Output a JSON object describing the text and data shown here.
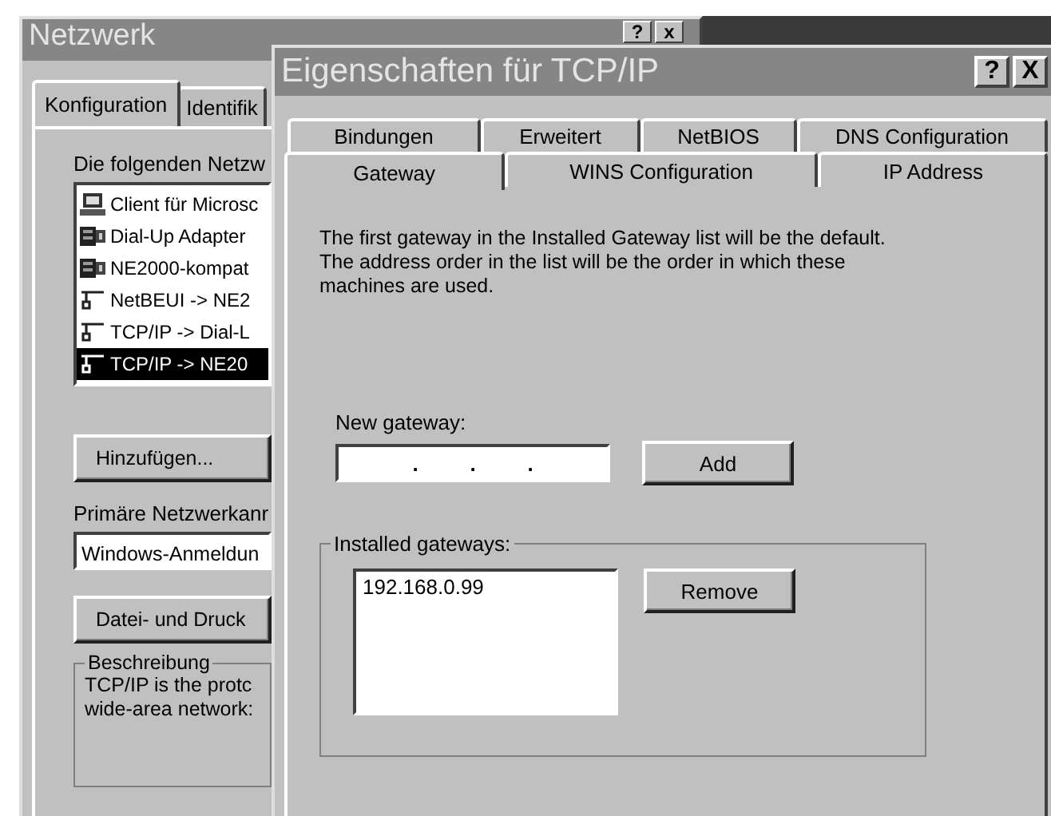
{
  "back_window": {
    "title": "Netzwerk",
    "title_buttons": [
      "?",
      "x"
    ],
    "tabs": [
      {
        "label": "Konfiguration",
        "selected": true
      },
      {
        "label": "Identifik",
        "selected": false
      }
    ],
    "list_label": "Die folgenden Netzw",
    "components": [
      {
        "kind": "client",
        "label": "Client für Microsc",
        "selected": false
      },
      {
        "kind": "adapter",
        "label": "Dial-Up Adapter",
        "selected": false
      },
      {
        "kind": "adapter",
        "label": "NE2000-kompat",
        "selected": false
      },
      {
        "kind": "protocol",
        "label": "NetBEUI -> NE2",
        "selected": false
      },
      {
        "kind": "protocol",
        "label": "TCP/IP -> Dial-L",
        "selected": false
      },
      {
        "kind": "protocol",
        "label": "TCP/IP -> NE20",
        "selected": true
      }
    ],
    "add_button": "Hinzufügen...",
    "logon_label": "Primäre Netzwerkanr",
    "logon_value": "Windows-Anmeldun",
    "sharing_button": "Datei- und Druck",
    "description": {
      "legend": "Beschreibung",
      "lines": [
        "TCP/IP is the protc",
        "wide-area network:"
      ]
    }
  },
  "window": {
    "title": "Eigenschaften für TCP/IP",
    "title_buttons": [
      "?",
      "X"
    ],
    "tab_rows": [
      [
        {
          "label": "Bindungen",
          "selected": false
        },
        {
          "label": "Erweitert",
          "selected": false
        },
        {
          "label": "NetBIOS",
          "selected": false
        },
        {
          "label": "DNS Configuration",
          "selected": false
        }
      ],
      [
        {
          "label": "Gateway",
          "selected": true
        },
        {
          "label": "WINS Configuration",
          "selected": false
        },
        {
          "label": "IP Address",
          "selected": false
        }
      ]
    ],
    "info_lines": [
      "The first gateway in the Installed Gateway list will be the default.",
      "The address order in the list will be the order in which these",
      "machines are used."
    ],
    "new_gateway_label": "New gateway:",
    "new_gateway_dots": [
      ".",
      ".",
      "."
    ],
    "add_button": "Add",
    "installed": {
      "legend": "Installed gateways:",
      "items": [
        "192.168.0.99"
      ],
      "remove_button": "Remove"
    }
  }
}
